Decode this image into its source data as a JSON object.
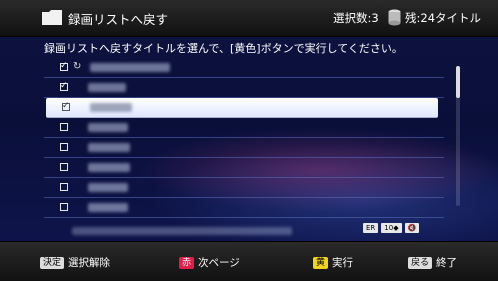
{
  "header": {
    "title": "録画リストへ戻す",
    "selected_count": "選択数:3",
    "remaining": "残:24タイトル",
    "folder_icon": "folder-icon",
    "disk_icon": "disk-icon"
  },
  "instruction": "録画リストへ戻すタイトルを選んで、[黄色]ボタンで実行してください。",
  "list": {
    "rows": [
      {
        "checked": true,
        "selected": false,
        "protected": true
      },
      {
        "checked": true,
        "selected": false,
        "protected": false
      },
      {
        "checked": true,
        "selected": true,
        "protected": false
      },
      {
        "checked": false,
        "selected": false,
        "protected": false
      },
      {
        "checked": false,
        "selected": false,
        "protected": false
      },
      {
        "checked": false,
        "selected": false,
        "protected": false
      },
      {
        "checked": false,
        "selected": false,
        "protected": false
      },
      {
        "checked": false,
        "selected": false,
        "protected": false
      }
    ]
  },
  "badges": [
    "ER",
    "10◆",
    "🔇"
  ],
  "footer": {
    "deselect_key": "決定",
    "deselect_label": "選択解除",
    "next_key": "赤",
    "next_label": "次ページ",
    "exec_key": "黄",
    "exec_label": "実行",
    "back_key": "戻る",
    "back_label": "終了"
  },
  "colors": {
    "red_key": "#e0204a",
    "yellow_key": "#f2d21b",
    "background": "#0a0f38"
  }
}
